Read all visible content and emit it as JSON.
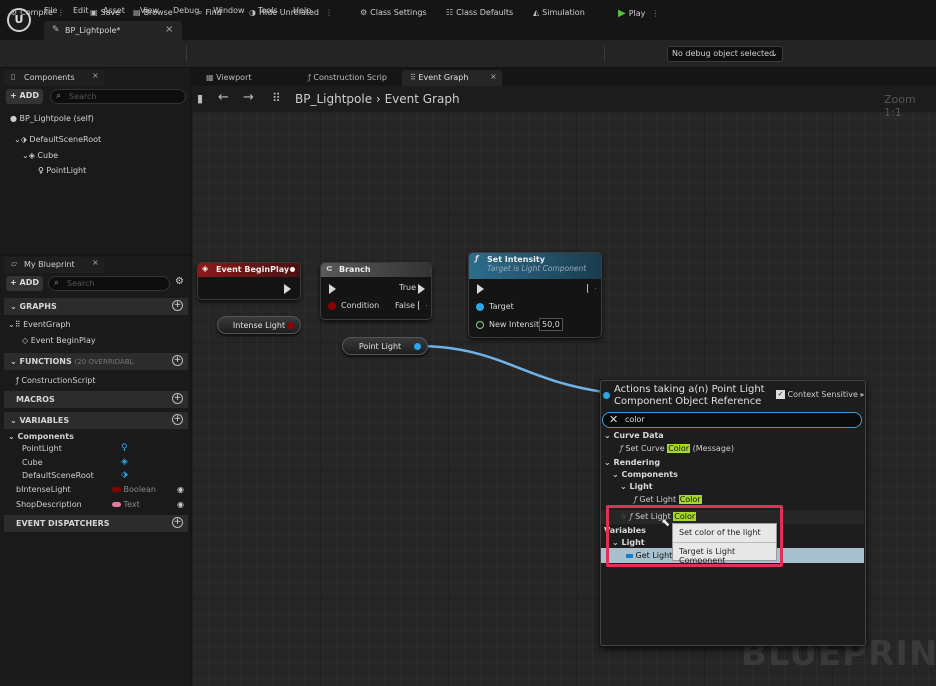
{
  "menu": [
    "File",
    "Edit",
    "Asset",
    "View",
    "Debug",
    "Window",
    "Tools",
    "Help"
  ],
  "document_tab": {
    "label": "BP_Lightpole*",
    "close": "×"
  },
  "toolbar": {
    "compile": "Compile",
    "save": "Save",
    "browse": "Browse",
    "find": "Find",
    "hide_unrelated": "Hide Unrelated",
    "class_settings": "Class Settings",
    "class_defaults": "Class Defaults",
    "simulation": "Simulation",
    "play": "Play",
    "debug_object": "No debug object selected"
  },
  "components_panel": {
    "tab": "Components",
    "close": "×",
    "add": "ADD",
    "search_placeholder": "Search",
    "tree": [
      "BP_Lightpole (self)",
      "DefaultSceneRoot",
      "Cube",
      "PointLight"
    ]
  },
  "my_blueprint": {
    "tab": "My Blueprint",
    "close": "×",
    "add": "ADD",
    "search_placeholder": "Search",
    "graphs_header": "GRAPHS",
    "graphs": [
      "EventGraph",
      "Event BeginPlay"
    ],
    "functions_header": "FUNCTIONS",
    "functions_note": "(20 OVERRIDABL",
    "functions": [
      "ConstructionScript"
    ],
    "macros_header": "MACROS",
    "variables_header": "VARIABLES",
    "components_group": "Components",
    "component_vars": [
      "PointLight",
      "Cube",
      "DefaultSceneRoot"
    ],
    "variables": [
      {
        "name": "bIntenseLight",
        "type": "Boolean",
        "color": "#8c0000"
      },
      {
        "name": "ShopDescription",
        "type": "Text",
        "color": "#e07c9c"
      }
    ],
    "dispatchers_header": "EVENT DISPATCHERS"
  },
  "graph_tabs": [
    "Viewport",
    "Construction Scrip",
    "Event Graph"
  ],
  "graph_tab_close": "×",
  "breadcrumb": {
    "root": "BP_Lightpole",
    "sep": "›",
    "current": "Event Graph"
  },
  "zoom": "Zoom 1:1",
  "watermark": "BLUEPRINT",
  "nodes": {
    "begin_play": {
      "title": "Event BeginPlay",
      "color": "#8b1a1a"
    },
    "branch": {
      "title": "Branch",
      "true_label": "True",
      "false_label": "False",
      "condition": "Condition"
    },
    "set_intensity": {
      "title": "Set Intensity",
      "subtitle": "Target is Light Component",
      "target": "Target",
      "new_intensity": "New Intensity",
      "intensity_value": "50,0"
    },
    "intense_light_var": "Intense Light",
    "point_light_var": "Point Light"
  },
  "popup": {
    "title_line1": "Actions taking a(n) Point Light",
    "title_line2": "Component Object Reference",
    "context_sensitive": "Context Sensitive",
    "search_value": "color",
    "curve_data": "Curve Data",
    "set_curve_color": {
      "before": "Set Curve ",
      "match": "Color",
      "after": " (Message)"
    },
    "rendering": "Rendering",
    "components": "Components",
    "light": "Light",
    "get_light_color": {
      "before": "Get Light ",
      "match": "Color"
    },
    "set_light_color": {
      "before": "Set Light ",
      "match": "Color"
    },
    "variables": "Variables",
    "light2": "Light",
    "get_light": "Get Light"
  },
  "tooltip": {
    "line1": "Set color of the light",
    "line2": "Target is Light Component"
  },
  "colors": {
    "accent_blue": "#3f9bd6",
    "highlight": "#e0305a",
    "match": "#a8d82a",
    "exec_pin": "#d9d9d9",
    "bool_pin": "#8c0000",
    "object_pin": "#2aa5e8"
  }
}
